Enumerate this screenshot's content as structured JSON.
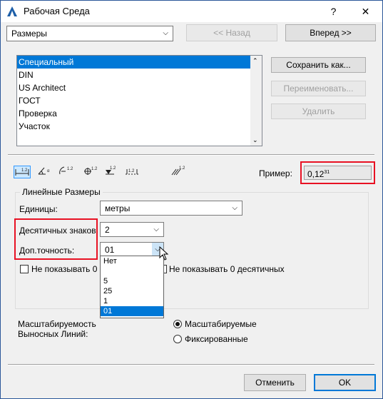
{
  "window": {
    "title": "Рабочая Среда",
    "help": "?",
    "close": "✕"
  },
  "nav": {
    "combo_value": "Размеры",
    "back_label": "<< Назад",
    "forward_label": "Вперед >>"
  },
  "schemes": {
    "items": [
      "Специальный",
      "DIN",
      "US Architect",
      "ГОСТ",
      "Проверка",
      "Участок"
    ],
    "selected_index": 0
  },
  "actions": {
    "save_as": "Сохранить как...",
    "rename": "Переименовать...",
    "delete": "Удалить"
  },
  "toolbar": {
    "icons": [
      "linear-dimension-icon",
      "angular-dimension-icon",
      "radial-dimension-icon",
      "level-dimension-icon",
      "elevation-dimension-icon",
      "door-window-dimension-icon",
      "area-dimension-icon"
    ],
    "preview_label": "Пример:",
    "preview_value": "0,12",
    "preview_sup": "31"
  },
  "linear": {
    "group_title": "Линейные Размеры",
    "units_label": "Единицы:",
    "units_value": "метры",
    "decimals_label": "Десятичных знаков:",
    "decimals_value": "2",
    "extra_label": "Доп.точность:",
    "extra_value": "01",
    "hide_zero_label_left": "Не показывать 0 ц",
    "hide_zero_label_right": "Не показывать 0 десятичных"
  },
  "dropdown": {
    "options": [
      "Нет",
      "",
      "5",
      "25",
      "1",
      "01"
    ],
    "selected_index": 5
  },
  "witness": {
    "label_line1": "Масштабируемость",
    "label_line2": "Выносных Линий:",
    "opt_scalable": "Масштабируемые",
    "opt_fixed": "Фиксированные",
    "selected": "Масштабируемые"
  },
  "footer": {
    "cancel": "Отменить",
    "ok": "OK"
  },
  "colors": {
    "accent": "#0078d7",
    "highlight_box": "#e81123"
  }
}
